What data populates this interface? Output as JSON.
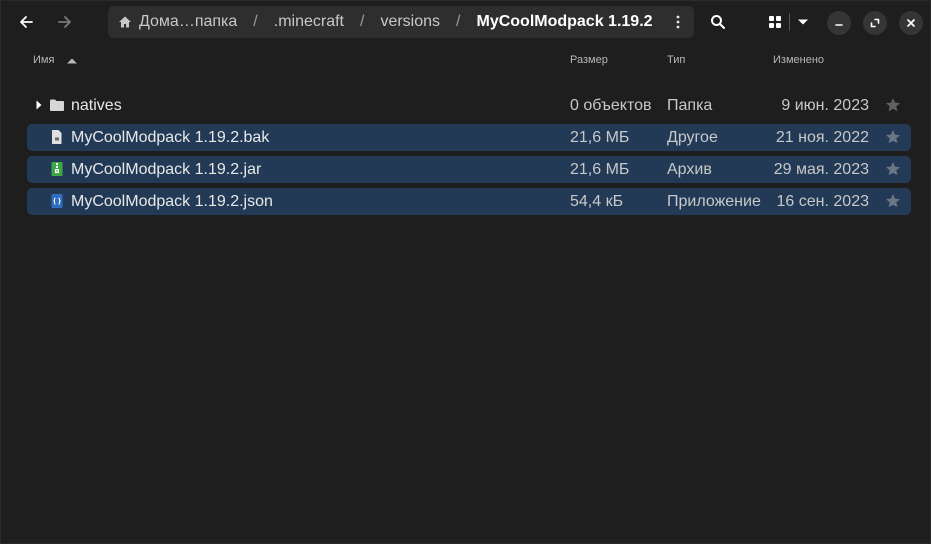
{
  "nav": {
    "back_icon": "arrow-left-icon",
    "forward_icon": "arrow-right-icon"
  },
  "pathbar": {
    "home_icon": "home-icon",
    "crumbs": [
      "Дома…папка",
      ".minecraft",
      "versions",
      "MyCoolModpack 1.19.2"
    ],
    "separator": "/",
    "menu_icon": "vertical-ellipsis-icon"
  },
  "toolbar": {
    "search_icon": "search-icon",
    "view_icon": "grid-view-icon",
    "view_dropdown_icon": "chevron-down-icon"
  },
  "window_controls": {
    "minimize_icon": "minimize-icon",
    "maximize_icon": "maximize-icon",
    "close_icon": "close-icon"
  },
  "columns": {
    "name": "Имя",
    "size": "Размер",
    "type": "Тип",
    "modified": "Изменено",
    "sort_icon": "sort-ascending-icon"
  },
  "files": [
    {
      "name": "natives",
      "size": "0 объектов",
      "type": "Папка",
      "modified": "9 июн. 2023",
      "icon": "folder-icon",
      "selected": false,
      "expandable": true
    },
    {
      "name": "MyCoolModpack 1.19.2.bak",
      "size": "21,6 МБ",
      "type": "Другое",
      "modified": "21 ноя. 2022",
      "icon": "generic-file-icon",
      "selected": true,
      "expandable": false
    },
    {
      "name": "MyCoolModpack 1.19.2.jar",
      "size": "21,6 МБ",
      "type": "Архив",
      "modified": "29 мая. 2023",
      "icon": "archive-file-icon",
      "selected": true,
      "expandable": false
    },
    {
      "name": "MyCoolModpack 1.19.2.json",
      "size": "54,4 кБ",
      "type": "Приложение",
      "modified": "16 сен. 2023",
      "icon": "json-file-icon",
      "selected": true,
      "expandable": false
    }
  ],
  "colors": {
    "background": "#1e1e1e",
    "selection": "#233a57",
    "pathbar": "#2e2e2e",
    "archive_green": "#3ea845",
    "json_blue": "#2f6fc2"
  }
}
